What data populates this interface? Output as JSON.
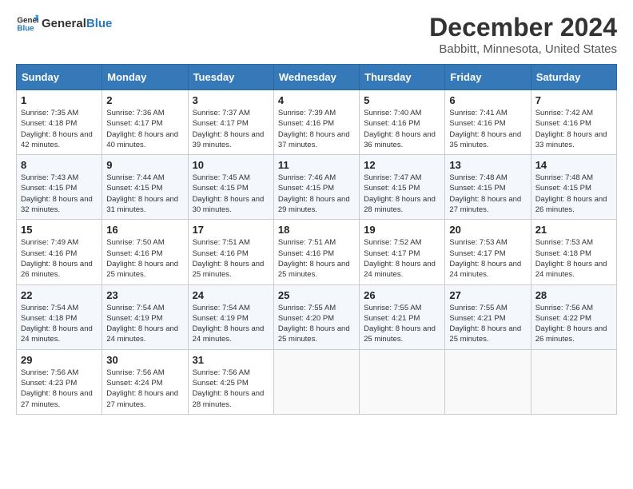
{
  "header": {
    "logo_general": "General",
    "logo_blue": "Blue",
    "title": "December 2024",
    "subtitle": "Babbitt, Minnesota, United States"
  },
  "days_of_week": [
    "Sunday",
    "Monday",
    "Tuesday",
    "Wednesday",
    "Thursday",
    "Friday",
    "Saturday"
  ],
  "weeks": [
    [
      {
        "day": "1",
        "sunrise": "Sunrise: 7:35 AM",
        "sunset": "Sunset: 4:18 PM",
        "daylight": "Daylight: 8 hours and 42 minutes."
      },
      {
        "day": "2",
        "sunrise": "Sunrise: 7:36 AM",
        "sunset": "Sunset: 4:17 PM",
        "daylight": "Daylight: 8 hours and 40 minutes."
      },
      {
        "day": "3",
        "sunrise": "Sunrise: 7:37 AM",
        "sunset": "Sunset: 4:17 PM",
        "daylight": "Daylight: 8 hours and 39 minutes."
      },
      {
        "day": "4",
        "sunrise": "Sunrise: 7:39 AM",
        "sunset": "Sunset: 4:16 PM",
        "daylight": "Daylight: 8 hours and 37 minutes."
      },
      {
        "day": "5",
        "sunrise": "Sunrise: 7:40 AM",
        "sunset": "Sunset: 4:16 PM",
        "daylight": "Daylight: 8 hours and 36 minutes."
      },
      {
        "day": "6",
        "sunrise": "Sunrise: 7:41 AM",
        "sunset": "Sunset: 4:16 PM",
        "daylight": "Daylight: 8 hours and 35 minutes."
      },
      {
        "day": "7",
        "sunrise": "Sunrise: 7:42 AM",
        "sunset": "Sunset: 4:16 PM",
        "daylight": "Daylight: 8 hours and 33 minutes."
      }
    ],
    [
      {
        "day": "8",
        "sunrise": "Sunrise: 7:43 AM",
        "sunset": "Sunset: 4:15 PM",
        "daylight": "Daylight: 8 hours and 32 minutes."
      },
      {
        "day": "9",
        "sunrise": "Sunrise: 7:44 AM",
        "sunset": "Sunset: 4:15 PM",
        "daylight": "Daylight: 8 hours and 31 minutes."
      },
      {
        "day": "10",
        "sunrise": "Sunrise: 7:45 AM",
        "sunset": "Sunset: 4:15 PM",
        "daylight": "Daylight: 8 hours and 30 minutes."
      },
      {
        "day": "11",
        "sunrise": "Sunrise: 7:46 AM",
        "sunset": "Sunset: 4:15 PM",
        "daylight": "Daylight: 8 hours and 29 minutes."
      },
      {
        "day": "12",
        "sunrise": "Sunrise: 7:47 AM",
        "sunset": "Sunset: 4:15 PM",
        "daylight": "Daylight: 8 hours and 28 minutes."
      },
      {
        "day": "13",
        "sunrise": "Sunrise: 7:48 AM",
        "sunset": "Sunset: 4:15 PM",
        "daylight": "Daylight: 8 hours and 27 minutes."
      },
      {
        "day": "14",
        "sunrise": "Sunrise: 7:48 AM",
        "sunset": "Sunset: 4:15 PM",
        "daylight": "Daylight: 8 hours and 26 minutes."
      }
    ],
    [
      {
        "day": "15",
        "sunrise": "Sunrise: 7:49 AM",
        "sunset": "Sunset: 4:16 PM",
        "daylight": "Daylight: 8 hours and 26 minutes."
      },
      {
        "day": "16",
        "sunrise": "Sunrise: 7:50 AM",
        "sunset": "Sunset: 4:16 PM",
        "daylight": "Daylight: 8 hours and 25 minutes."
      },
      {
        "day": "17",
        "sunrise": "Sunrise: 7:51 AM",
        "sunset": "Sunset: 4:16 PM",
        "daylight": "Daylight: 8 hours and 25 minutes."
      },
      {
        "day": "18",
        "sunrise": "Sunrise: 7:51 AM",
        "sunset": "Sunset: 4:16 PM",
        "daylight": "Daylight: 8 hours and 25 minutes."
      },
      {
        "day": "19",
        "sunrise": "Sunrise: 7:52 AM",
        "sunset": "Sunset: 4:17 PM",
        "daylight": "Daylight: 8 hours and 24 minutes."
      },
      {
        "day": "20",
        "sunrise": "Sunrise: 7:53 AM",
        "sunset": "Sunset: 4:17 PM",
        "daylight": "Daylight: 8 hours and 24 minutes."
      },
      {
        "day": "21",
        "sunrise": "Sunrise: 7:53 AM",
        "sunset": "Sunset: 4:18 PM",
        "daylight": "Daylight: 8 hours and 24 minutes."
      }
    ],
    [
      {
        "day": "22",
        "sunrise": "Sunrise: 7:54 AM",
        "sunset": "Sunset: 4:18 PM",
        "daylight": "Daylight: 8 hours and 24 minutes."
      },
      {
        "day": "23",
        "sunrise": "Sunrise: 7:54 AM",
        "sunset": "Sunset: 4:19 PM",
        "daylight": "Daylight: 8 hours and 24 minutes."
      },
      {
        "day": "24",
        "sunrise": "Sunrise: 7:54 AM",
        "sunset": "Sunset: 4:19 PM",
        "daylight": "Daylight: 8 hours and 24 minutes."
      },
      {
        "day": "25",
        "sunrise": "Sunrise: 7:55 AM",
        "sunset": "Sunset: 4:20 PM",
        "daylight": "Daylight: 8 hours and 25 minutes."
      },
      {
        "day": "26",
        "sunrise": "Sunrise: 7:55 AM",
        "sunset": "Sunset: 4:21 PM",
        "daylight": "Daylight: 8 hours and 25 minutes."
      },
      {
        "day": "27",
        "sunrise": "Sunrise: 7:55 AM",
        "sunset": "Sunset: 4:21 PM",
        "daylight": "Daylight: 8 hours and 25 minutes."
      },
      {
        "day": "28",
        "sunrise": "Sunrise: 7:56 AM",
        "sunset": "Sunset: 4:22 PM",
        "daylight": "Daylight: 8 hours and 26 minutes."
      }
    ],
    [
      {
        "day": "29",
        "sunrise": "Sunrise: 7:56 AM",
        "sunset": "Sunset: 4:23 PM",
        "daylight": "Daylight: 8 hours and 27 minutes."
      },
      {
        "day": "30",
        "sunrise": "Sunrise: 7:56 AM",
        "sunset": "Sunset: 4:24 PM",
        "daylight": "Daylight: 8 hours and 27 minutes."
      },
      {
        "day": "31",
        "sunrise": "Sunrise: 7:56 AM",
        "sunset": "Sunset: 4:25 PM",
        "daylight": "Daylight: 8 hours and 28 minutes."
      },
      null,
      null,
      null,
      null
    ]
  ]
}
